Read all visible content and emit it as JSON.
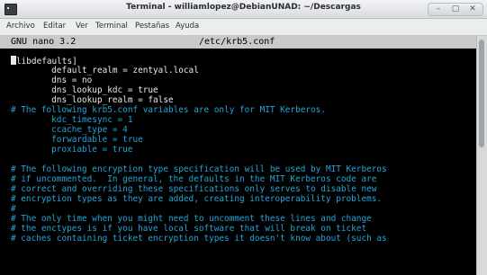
{
  "window": {
    "title": "Terminal - williamlopez@DebianUNAD: ~/Descargas",
    "controls": [
      "–",
      "▢",
      "✕"
    ]
  },
  "menubar": {
    "items": [
      "Archivo",
      "Editar",
      "Ver",
      "Terminal",
      "Pestañas",
      "Ayuda"
    ]
  },
  "nano": {
    "version": "GNU nano 3.2",
    "filename": "/etc/krb5.conf"
  },
  "file_lines": [
    {
      "type": "code",
      "text": "libdefaults]",
      "cursor": true
    },
    {
      "type": "code",
      "text": "        default_realm = zentyal.local"
    },
    {
      "type": "code",
      "text": "        dns = no"
    },
    {
      "type": "code",
      "text": "        dns_lookup_kdc = true"
    },
    {
      "type": "code",
      "text": "        dns_lookup_realm = false"
    },
    {
      "type": "comment",
      "text": "# The following krb5.conf variables are only for MIT Kerberos."
    },
    {
      "type": "comment",
      "text": "        kdc_timesync = 1"
    },
    {
      "type": "comment",
      "text": "        ccache_type = 4"
    },
    {
      "type": "comment",
      "text": "        forwardable = true"
    },
    {
      "type": "comment",
      "text": "        proxiable = true"
    },
    {
      "type": "comment",
      "text": ""
    },
    {
      "type": "comment",
      "text": "# The following encryption type specification will be used by MIT Kerberos"
    },
    {
      "type": "comment",
      "text": "# if uncommented.  In general, the defaults in the MIT Kerberos code are"
    },
    {
      "type": "comment",
      "text": "# correct and overriding these specifications only serves to disable new"
    },
    {
      "type": "comment",
      "text": "# encryption types as they are added, creating interoperability problems."
    },
    {
      "type": "comment",
      "text": "#"
    },
    {
      "type": "comment",
      "text": "# The only time when you might need to uncomment these lines and change"
    },
    {
      "type": "comment",
      "text": "# the enctypes is if you have local software that will break on ticket"
    },
    {
      "type": "comment",
      "text": "# caches containing ticket encryption types it doesn't know about (such as"
    }
  ],
  "colors": {
    "terminal_bg": "#000000",
    "code_text": "#e9e9e9",
    "comment_text": "#23a5d6",
    "nano_header_bg": "#c9c9c9"
  }
}
